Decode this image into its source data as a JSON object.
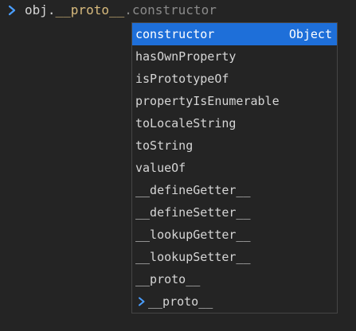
{
  "console": {
    "input": {
      "prefix": "obj.",
      "member": "__proto__",
      "ghost": ".constructor"
    },
    "colors": {
      "background": "#242424",
      "prompt_chevron": "#4a9eff",
      "selection": "#1e6fd9",
      "proto_token": "#d7ba7d",
      "ghost_text": "#8a8a8a"
    }
  },
  "autocomplete": {
    "items": [
      {
        "label": "constructor",
        "type": "Object",
        "selected": true
      },
      {
        "label": "hasOwnProperty"
      },
      {
        "label": "isPrototypeOf"
      },
      {
        "label": "propertyIsEnumerable"
      },
      {
        "label": "toLocaleString"
      },
      {
        "label": "toString"
      },
      {
        "label": "valueOf"
      },
      {
        "label": "__defineGetter__"
      },
      {
        "label": "__defineSetter__"
      },
      {
        "label": "__lookupGetter__"
      },
      {
        "label": "__lookupSetter__"
      },
      {
        "label": "__proto__"
      },
      {
        "label": "__proto__",
        "icon": "chevron-right-icon"
      }
    ]
  }
}
